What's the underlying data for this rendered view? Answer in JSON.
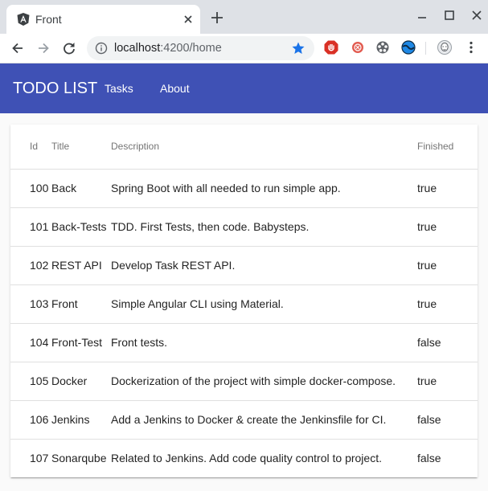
{
  "browser": {
    "tab_title": "Front",
    "url_host": "localhost",
    "url_rest": ":4200/home"
  },
  "app": {
    "title": "TODO LIST",
    "nav": [
      {
        "label": "Tasks"
      },
      {
        "label": "About"
      }
    ]
  },
  "table": {
    "columns": [
      "Id",
      "Title",
      "Description",
      "Finished"
    ],
    "rows": [
      {
        "id": "100",
        "title": "Back",
        "description": "Spring Boot with all needed to run simple app.",
        "finished": "true"
      },
      {
        "id": "101",
        "title": "Back-Tests",
        "description": "TDD. First Tests, then code. Babysteps.",
        "finished": "true"
      },
      {
        "id": "102",
        "title": "REST API",
        "description": "Develop Task REST API.",
        "finished": "true"
      },
      {
        "id": "103",
        "title": "Front",
        "description": "Simple Angular CLI using Material.",
        "finished": "true"
      },
      {
        "id": "104",
        "title": "Front-Test",
        "description": "Front tests.",
        "finished": "false"
      },
      {
        "id": "105",
        "title": "Docker",
        "description": "Dockerization of the project with simple docker-compose.",
        "finished": "true"
      },
      {
        "id": "106",
        "title": "Jenkins",
        "description": "Add a Jenkins to Docker & create the Jenkinsfile for CI.",
        "finished": "false"
      },
      {
        "id": "107",
        "title": "Sonarqube",
        "description": "Related to Jenkins. Add code quality control to project.",
        "finished": "false"
      }
    ]
  },
  "colors": {
    "appbar": "#3f51b5",
    "tabstrip": "#dee1e6",
    "star": "#1a73e8"
  },
  "icons": [
    "angular-favicon-icon",
    "close-icon",
    "plus-icon",
    "minimize-icon",
    "maximize-icon",
    "window-close-icon",
    "back-arrow-icon",
    "forward-arrow-icon",
    "reload-icon",
    "info-icon",
    "star-icon",
    "ublock-extension-icon",
    "red-circle-extension-icon",
    "film-reel-extension-icon",
    "globe-extension-icon",
    "profile-avatar-icon",
    "menu-kebab-icon"
  ]
}
